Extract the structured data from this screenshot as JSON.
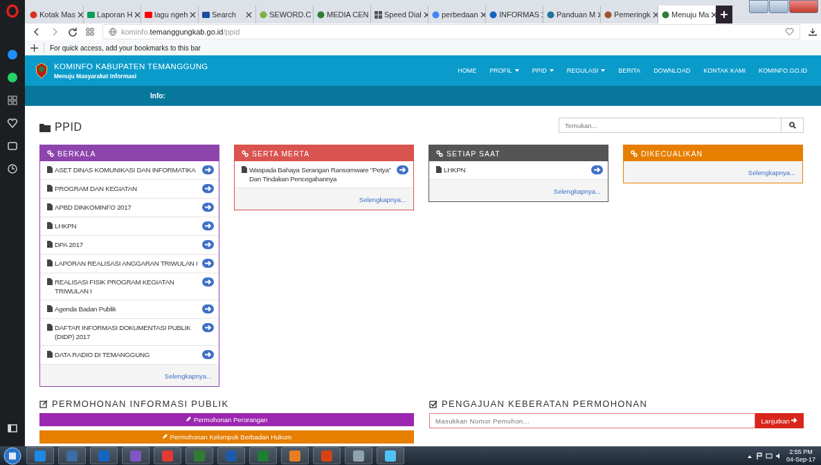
{
  "browser": {
    "tabs": [
      {
        "label": "Kotak Mas",
        "kind": "mail",
        "selected": false
      },
      {
        "label": "Laporan H",
        "kind": "sheet",
        "selected": false
      },
      {
        "label": "lagu ngeh",
        "kind": "video",
        "selected": false
      },
      {
        "label": "Search",
        "kind": "search",
        "selected": false
      },
      {
        "label": "SEWORD.C",
        "kind": "leaf",
        "selected": false
      },
      {
        "label": "MEDIA CEN",
        "kind": "emblem",
        "selected": false
      },
      {
        "label": "Speed Dial",
        "kind": "grid",
        "selected": false
      },
      {
        "label": "perbedaan",
        "kind": "google",
        "selected": false
      },
      {
        "label": "INFORMAS",
        "kind": "globe",
        "selected": false
      },
      {
        "label": "Panduan M",
        "kind": "wp",
        "selected": false
      },
      {
        "label": "Pemeringk",
        "kind": "bird",
        "selected": false
      },
      {
        "label": "Menuju Ma",
        "kind": "emblem",
        "selected": true
      }
    ],
    "address": {
      "prefix": "kominfo.",
      "domain": "temanggungkab.go.id",
      "path": "/ppid"
    },
    "bookmarks_hint": "For quick access, add your bookmarks to this bar"
  },
  "site": {
    "title": "KOMINFO KABUPATEN TEMANGGUNG",
    "tagline": "Menuju Masyarakat Informasi",
    "nav": [
      {
        "label": "HOME",
        "dropdown": false
      },
      {
        "label": "PROFIL",
        "dropdown": true
      },
      {
        "label": "PPID",
        "dropdown": true
      },
      {
        "label": "REGULASI",
        "dropdown": true
      },
      {
        "label": "BERITA",
        "dropdown": false
      },
      {
        "label": "DOWNLOAD",
        "dropdown": false
      },
      {
        "label": "KONTAK KAMI",
        "dropdown": false
      },
      {
        "label": "KOMINFO.GO.ID",
        "dropdown": false
      }
    ],
    "info_label": "Info:",
    "page_title": "PPID",
    "search": {
      "placeholder": "Temukan..."
    },
    "panels": [
      {
        "title": "BERKALA",
        "color": "#8e44ad",
        "more": "Selengkapnya...",
        "items": [
          "ASET DINAS KOMUNIKASI DAN INFORMATIKA",
          "PROGRAM DAN KEGIATAN",
          "APBD DINKOMINFO 2017",
          "LHKPN",
          "DPA 2017",
          "LAPORAN REALISASI ANGGARAN TRIWULAN I",
          "REALISASI FISIK PROGRAM KEGIATAN TRIWULAN I",
          "Agenda Badan Publik",
          "DAFTAR INFORMASI DOKUMENTASI PUBLIK (DIDP) 2017",
          "DATA RADIO DI TEMANGGUNG"
        ]
      },
      {
        "title": "SERTA MERTA",
        "color": "#d9534f",
        "more": "Selengkapnya...",
        "items": [
          "Waspada Bahaya Serangan Ransomware \"Petya\" Dan Tindakan Pencegahannya"
        ]
      },
      {
        "title": "SETIAP SAAT",
        "color": "#555555",
        "more": "Selengkapnya...",
        "items": [
          "LHKPN"
        ]
      },
      {
        "title": "DIKECUALIKAN",
        "color": "#e67e00",
        "more": "Selengkapnya..."
      }
    ],
    "request": {
      "title": "PERMOHONAN INFORMASI PUBLIK",
      "buttons": [
        {
          "label": "Permohonan Perorangan",
          "color": "#9c27b0"
        },
        {
          "label": "Permohonan Kelompok Berbadan Hukum",
          "color": "#e67e00"
        }
      ]
    },
    "objection": {
      "title": "PENGAJUAN KEBERATAN PERMOHONAN",
      "placeholder": "Masukkan Nomor Pemohon...",
      "button": "Lanjutkan"
    }
  },
  "taskbar": {
    "time": "2:55 PM",
    "date": "04-Sep-17"
  }
}
